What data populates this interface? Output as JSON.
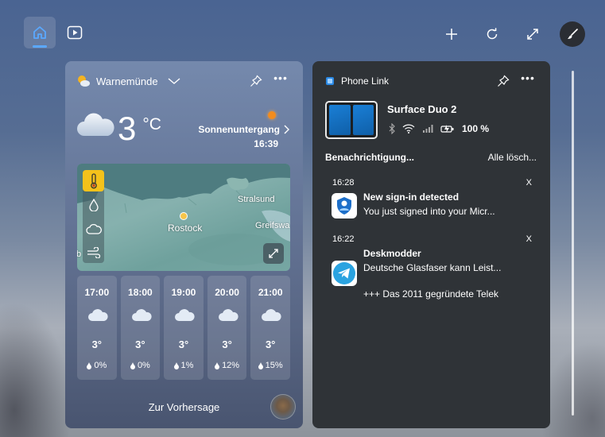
{
  "weather": {
    "location": "Warnemünde",
    "temperature": "3",
    "unit": "°C",
    "sun_label": "Sonnenuntergang",
    "sun_time": "16:39",
    "map": {
      "cities": {
        "rostock": "Rostock",
        "stralsund": "Stralsund",
        "greifswald": "Greifswa",
        "partial_left": "b"
      }
    },
    "forecast": [
      {
        "time": "17:00",
        "temp": "3°",
        "precip": "0%"
      },
      {
        "time": "18:00",
        "temp": "3°",
        "precip": "0%"
      },
      {
        "time": "19:00",
        "temp": "3°",
        "precip": "1%"
      },
      {
        "time": "20:00",
        "temp": "3°",
        "precip": "12%"
      },
      {
        "time": "21:00",
        "temp": "3°",
        "precip": "15%"
      }
    ],
    "forecast_link": "Zur Vorhersage"
  },
  "phone": {
    "app_name": "Phone Link",
    "device_name": "Surface Duo 2",
    "battery": "100 %",
    "notifications_title": "Benachrichtigung...",
    "clear_all": "Alle lösch...",
    "notifications": [
      {
        "time": "16:28",
        "close": "X",
        "app": "New sign-in detected",
        "body": "You just signed into your Micr...",
        "body2": ""
      },
      {
        "time": "16:22",
        "close": "X",
        "app": "Deskmodder",
        "body": "Deutsche Glasfaser kann Leist...",
        "body2": "+++ Das 2011 gegründete Telek"
      }
    ]
  },
  "colors": {
    "accent": "#5aa8ff",
    "sun": "#f28c1e",
    "temp_layer": "#f4c21b",
    "telegram": "#2aa3e0",
    "authenticator": "#1d6fc9"
  },
  "icons": {
    "home": "home-icon",
    "play": "play-icon",
    "add": "plus-icon",
    "refresh": "refresh-icon",
    "expand": "expand-icon",
    "brush": "brush-icon"
  }
}
